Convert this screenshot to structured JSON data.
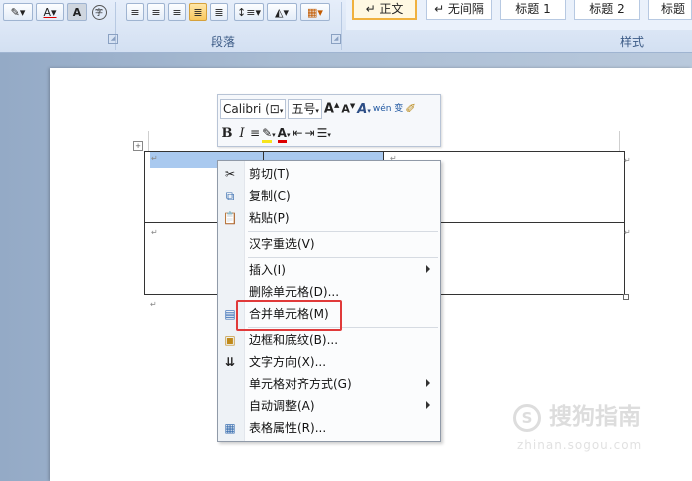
{
  "ribbon": {
    "paragraph_group_label": "段落",
    "styles_group_label": "样式",
    "styles": [
      "↵ 正文",
      "↵ 无间隔",
      "标题 1",
      "标题 2",
      "标题"
    ]
  },
  "mini_toolbar": {
    "font_name": "Calibri (⊡",
    "font_size": "五号",
    "grow_font": "A",
    "shrink_font": "A",
    "styles_glyph": "A",
    "phonetic_glyph": "wén 变",
    "bold": "B",
    "italic": "I",
    "font_color": "A"
  },
  "context_menu": {
    "items": [
      {
        "label": "剪切(T)",
        "icon": "scissors-icon"
      },
      {
        "label": "复制(C)",
        "icon": "copy-icon"
      },
      {
        "label": "粘贴(P)",
        "icon": "paste-icon"
      },
      {
        "label": "汉字重选(V)"
      },
      {
        "label": "插入(I)",
        "submenu": true
      },
      {
        "label": "删除单元格(D)..."
      },
      {
        "label": "合并单元格(M)",
        "icon": "merge-cells-icon",
        "highlighted": true
      },
      {
        "label": "边框和底纹(B)...",
        "icon": "borders-icon"
      },
      {
        "label": "文字方向(X)...",
        "icon": "text-direction-icon"
      },
      {
        "label": "单元格对齐方式(G)",
        "submenu": true
      },
      {
        "label": "自动调整(A)",
        "submenu": true
      },
      {
        "label": "表格属性(R)...",
        "icon": "table-properties-icon"
      }
    ]
  },
  "watermark": {
    "brand": "搜狗指南",
    "url": "zhinan.sogou.com"
  },
  "colors": {
    "highlight_border": "#e03a3a",
    "selection": "#a9c9ef",
    "ribbon": "#dbe6f4"
  }
}
